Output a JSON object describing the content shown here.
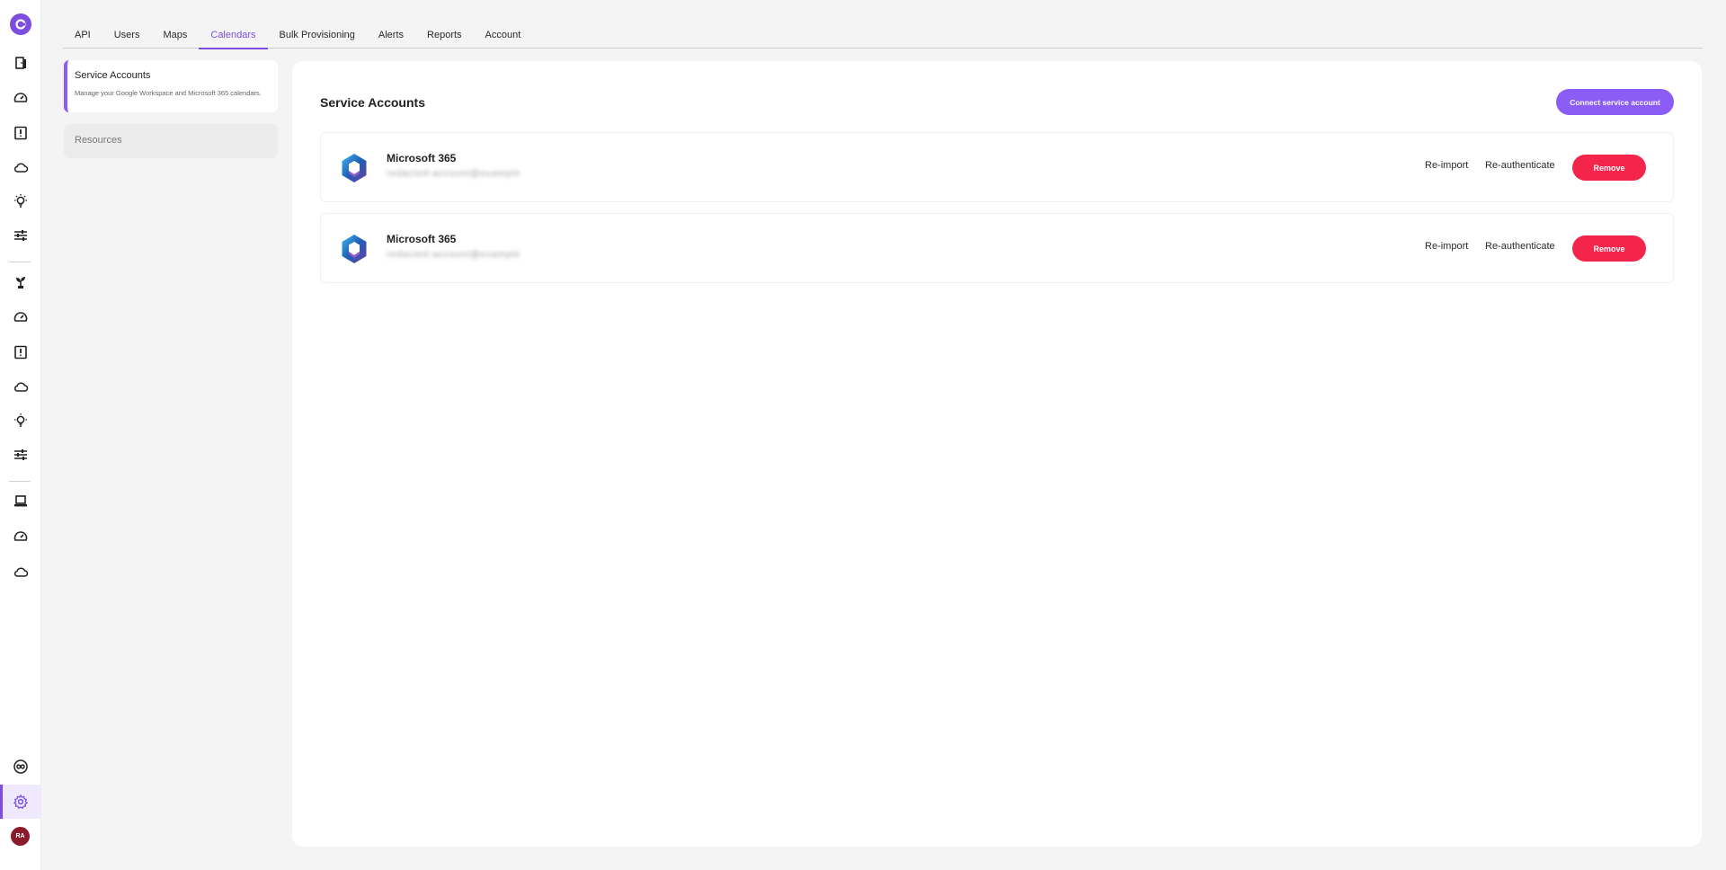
{
  "tabs": [
    {
      "label": "API"
    },
    {
      "label": "Users"
    },
    {
      "label": "Maps"
    },
    {
      "label": "Calendars",
      "active": true
    },
    {
      "label": "Bulk Provisioning"
    },
    {
      "label": "Alerts"
    },
    {
      "label": "Reports"
    },
    {
      "label": "Account"
    }
  ],
  "subnav": {
    "service_accounts": {
      "title": "Service Accounts",
      "description": "Manage your Google Workspace and Microsoft 365 calendars."
    },
    "resources": {
      "title": "Resources"
    }
  },
  "main": {
    "title": "Service Accounts",
    "connect_label": "Connect service account",
    "accounts": [
      {
        "provider": "Microsoft 365",
        "email": "redacted-account@example",
        "reimport_label": "Re-import",
        "reauth_label": "Re-authenticate",
        "remove_label": "Remove"
      },
      {
        "provider": "Microsoft 365",
        "email": "redacted-account@example",
        "reimport_label": "Re-import",
        "reauth_label": "Re-authenticate",
        "remove_label": "Remove"
      }
    ]
  },
  "user": {
    "initials": "RA"
  },
  "colors": {
    "accent": "#8b5cf6",
    "danger": "#f4254b",
    "avatar": "#8b1a2b"
  },
  "rail_icons": [
    "door-icon",
    "speedometer-icon",
    "alert-tablet-icon",
    "cloud-icon",
    "lightbulb-icon",
    "sliders-icon",
    "plant-icon",
    "speedometer-icon",
    "alert-tablet-icon",
    "cloud-icon",
    "lightbulb-icon",
    "sliders-icon",
    "laptop-icon",
    "speedometer-icon",
    "cloud-icon",
    "infinity-icon",
    "gear-icon"
  ]
}
